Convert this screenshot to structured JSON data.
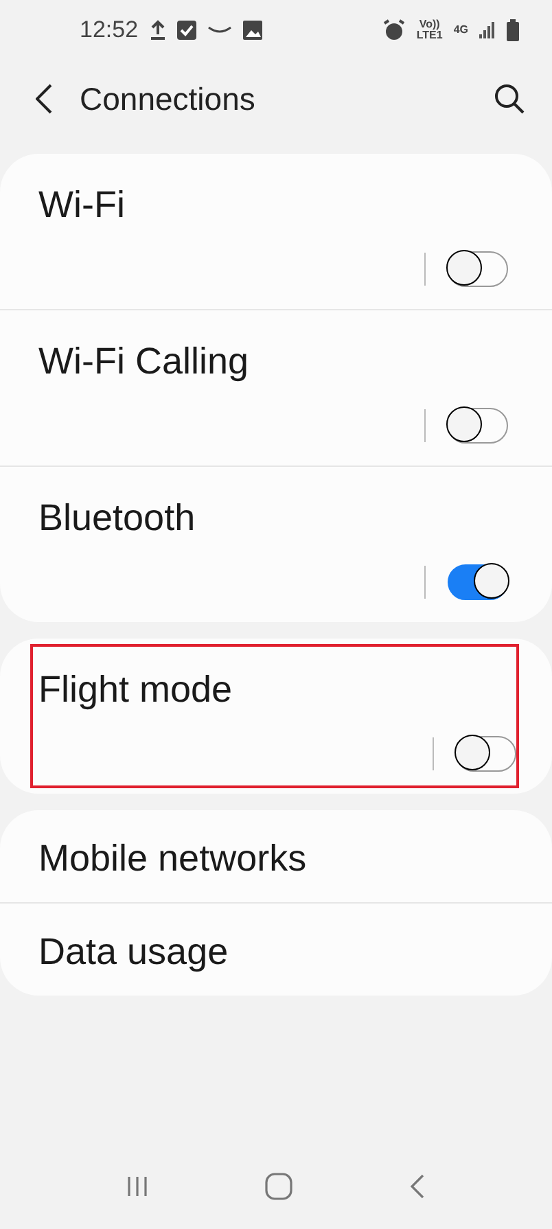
{
  "status_bar": {
    "time": "12:52",
    "volte": "Vo))",
    "lte": "LTE1",
    "network": "4G"
  },
  "header": {
    "title": "Connections"
  },
  "groups": [
    {
      "items": [
        {
          "kind": "toggle",
          "label": "Wi‑Fi",
          "on": false,
          "highlighted": false
        },
        {
          "kind": "toggle",
          "label": "Wi‑Fi Calling",
          "on": false,
          "highlighted": false
        },
        {
          "kind": "toggle",
          "label": "Bluetooth",
          "on": true,
          "highlighted": false
        }
      ]
    },
    {
      "items": [
        {
          "kind": "toggle",
          "label": "Flight mode",
          "on": false,
          "highlighted": true
        }
      ]
    },
    {
      "items": [
        {
          "kind": "link",
          "label": "Mobile networks",
          "highlighted": false
        },
        {
          "kind": "link",
          "label": "Data usage",
          "highlighted": false
        }
      ]
    }
  ]
}
